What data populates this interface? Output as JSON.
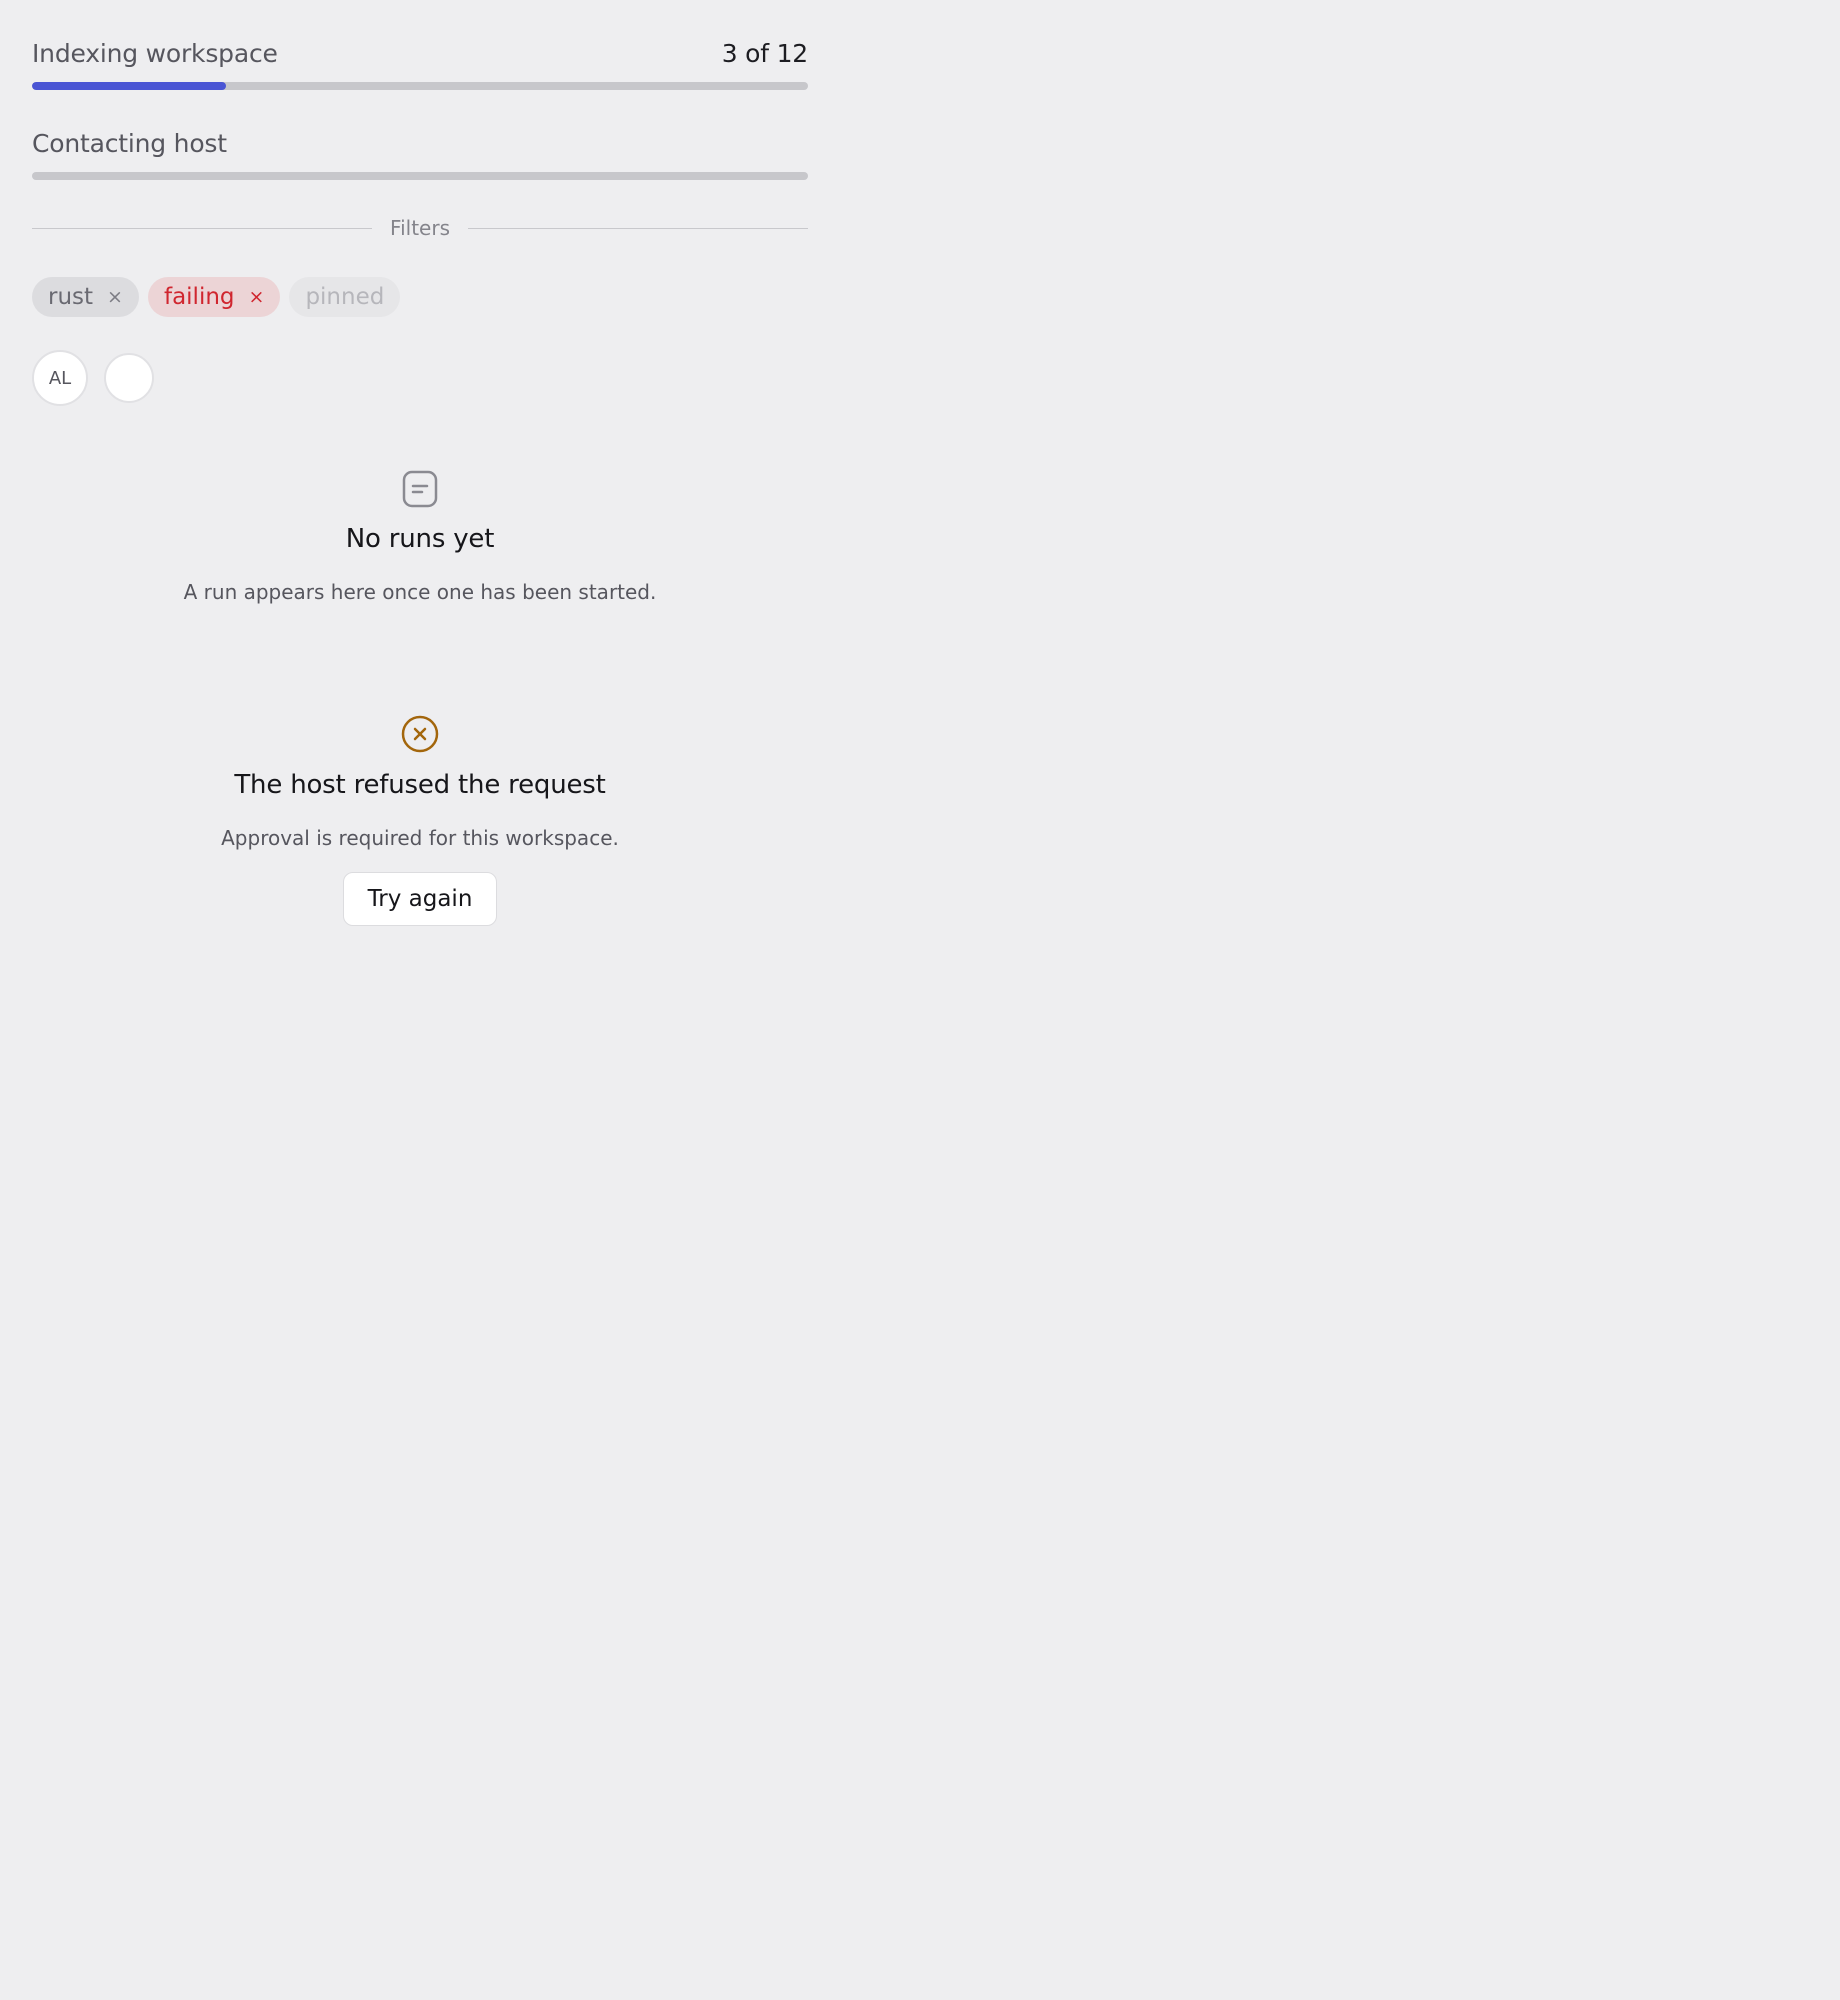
{
  "progress": [
    {
      "label": "Indexing workspace",
      "count": "3 of 12",
      "fraction": 0.25,
      "color": "#4a55d4"
    },
    {
      "label": "Contacting host",
      "count": "",
      "fraction": 0
    }
  ],
  "filters": {
    "label": "Filters",
    "chips": [
      {
        "label": "rust",
        "removable": true,
        "tone": "neutral"
      },
      {
        "label": "failing",
        "removable": true,
        "tone": "danger",
        "color": "#d0262f"
      },
      {
        "label": "pinned",
        "removable": false,
        "tone": "disabled"
      }
    ],
    "remove_glyph": "×"
  },
  "avatars": [
    {
      "initials": "AL"
    },
    {
      "initials": ""
    }
  ],
  "empty_state": {
    "icon": "document-icon",
    "title": "No runs yet",
    "text": "A run appears here once one has been started."
  },
  "error_state": {
    "icon": "error-circle-icon",
    "icon_color": "#a3660c",
    "title": "The host refused the request",
    "text": "Approval is required for this workspace.",
    "button_label": "Try again"
  }
}
